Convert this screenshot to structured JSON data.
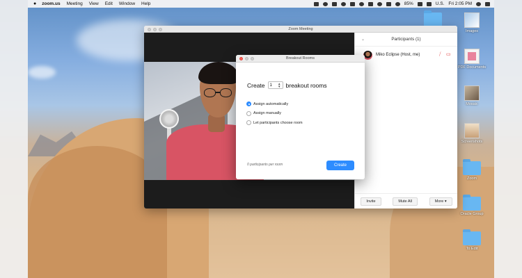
{
  "menubar": {
    "app_name": "zoom.us",
    "menus": [
      "Meeting",
      "View",
      "Edit",
      "Window",
      "Help"
    ],
    "battery": "85%",
    "locale": "U.S.",
    "clock": "Fri 2:05 PM"
  },
  "desktop_icons": [
    {
      "label": "",
      "kind": "folder"
    },
    {
      "label": "Images",
      "kind": "img"
    },
    {
      "label": "PDF Documents",
      "kind": "pdf"
    },
    {
      "label": "Mosaic",
      "kind": "mosaic"
    },
    {
      "label": "Screenshots",
      "kind": "shot"
    },
    {
      "label": "Zoom",
      "kind": "folder"
    },
    {
      "label": "Oracle Group",
      "kind": "folder"
    },
    {
      "label": "To Edit",
      "kind": "folder"
    }
  ],
  "zoom_window": {
    "title": "Zoom Meeting"
  },
  "participants": {
    "header": "Participants (1)",
    "list": [
      {
        "name": "Miko Eclipse (Host, me)"
      }
    ],
    "invite_label": "Invite",
    "mute_all_label": "Mute All",
    "more_label": "More ▾"
  },
  "breakout": {
    "title": "Breakout Rooms",
    "create_prefix": "Create",
    "room_count": "1",
    "create_suffix": "breakout rooms",
    "options": [
      {
        "label": "Assign automatically",
        "selected": true
      },
      {
        "label": "Assign manually",
        "selected": false
      },
      {
        "label": "Let participants choose room",
        "selected": false
      }
    ],
    "per_room_text": "0 participants per room",
    "create_button": "Create"
  },
  "colors": {
    "accent_blue": "#2d8cff",
    "mute_red": "#e03636"
  }
}
